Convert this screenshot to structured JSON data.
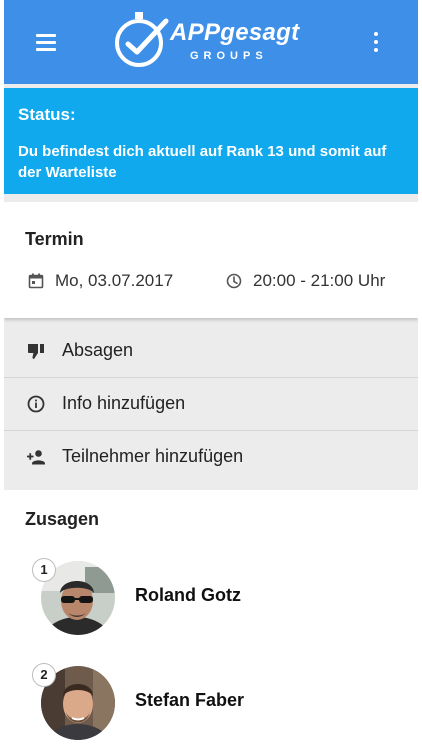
{
  "header": {
    "logo_text": "APPgesagt",
    "logo_subtext": "GROUPS",
    "menu_icon": "hamburger-menu-icon",
    "more_icon": "more-vertical-icon"
  },
  "status": {
    "title": "Status:",
    "message_prefix": "Du befindest dich aktuell auf ",
    "rank_text": "Rank 13",
    "message_suffix": " und somit auf der Warteliste"
  },
  "termin": {
    "title": "Termin",
    "date": "Mo, 03.07.2017",
    "time": "20:00 - 21:00 Uhr",
    "date_icon": "calendar-icon",
    "time_icon": "clock-icon"
  },
  "actions": [
    {
      "label": "Absagen",
      "icon": "thumbs-down-icon"
    },
    {
      "label": "Info hinzufügen",
      "icon": "info-icon"
    },
    {
      "label": "Teilnehmer hinzufügen",
      "icon": "add-person-icon"
    }
  ],
  "zusagen": {
    "title": "Zusagen",
    "people": [
      {
        "rank": "1",
        "name": "Roland Gotz"
      },
      {
        "rank": "2",
        "name": "Stefan Faber"
      }
    ]
  },
  "colors": {
    "appbar": "#3d8fe8",
    "status_banner": "#10a9ee",
    "background": "#ececec"
  }
}
